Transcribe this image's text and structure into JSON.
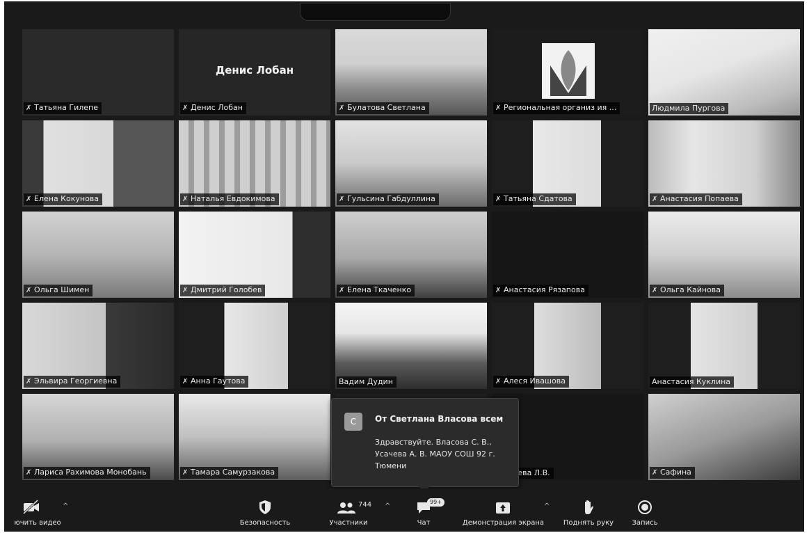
{
  "participants": [
    {
      "name": "Татьяна Гилепе",
      "display": "",
      "muted": true
    },
    {
      "name": "Денис Лобан",
      "display": "Денис Лобан",
      "muted": true
    },
    {
      "name": "Булатова Светлана",
      "display": "",
      "muted": true
    },
    {
      "name": "Региональная организ ия ...",
      "display": "",
      "muted": true
    },
    {
      "name": "Людмила Пургова",
      "display": "",
      "muted": false
    },
    {
      "name": "Елена Кокунова",
      "display": "",
      "muted": true
    },
    {
      "name": "Наталья Евдокимова",
      "display": "",
      "muted": true
    },
    {
      "name": "Гульсина Габдуллина",
      "display": "",
      "muted": true
    },
    {
      "name": "Татьяна Сдатова",
      "display": "",
      "muted": true
    },
    {
      "name": "Анастасия Попаева",
      "display": "",
      "muted": true
    },
    {
      "name": "Ольга Шимен",
      "display": "",
      "muted": true
    },
    {
      "name": "Дмитрий Голобев",
      "display": "",
      "muted": true
    },
    {
      "name": "Елена Ткаченко",
      "display": "",
      "muted": true
    },
    {
      "name": "Анастасия Рязапова",
      "display": "",
      "muted": true
    },
    {
      "name": "Ольга Кайнова",
      "display": "",
      "muted": true
    },
    {
      "name": "Эльвира Георгиевна",
      "display": "",
      "muted": true
    },
    {
      "name": "Анна Гаутова",
      "display": "",
      "muted": true
    },
    {
      "name": "Вадим Дудин",
      "display": "",
      "muted": false
    },
    {
      "name": "Алеся Ивашова",
      "display": "",
      "muted": true
    },
    {
      "name": "Анастасия Куклина",
      "display": "",
      "muted": false
    },
    {
      "name": "Лариса Рахимова Монобань",
      "display": "",
      "muted": true
    },
    {
      "name": "Тамара Самурзакова",
      "display": "",
      "muted": true
    },
    {
      "name": "",
      "display": "",
      "muted": false
    },
    {
      "name": "Шаблева Л.В.",
      "display": "",
      "muted": false
    },
    {
      "name": "Сафина",
      "display": "",
      "muted": true
    }
  ],
  "chat_popup": {
    "avatar_letter": "С",
    "sender": "От Светлана Власова всем",
    "message": "Здравствуйте. Власова С. В., Усачева А. В. МАОУ СОШ 92 г. Тюмени"
  },
  "toolbar": {
    "video_label": "ючить видео",
    "security_label": "Безопасность",
    "participants_label": "Участники",
    "participants_count": "744",
    "chat_label": "Чат",
    "chat_badge": "99+",
    "share_label": "Демонстрация экрана",
    "raise_hand_label": "Поднять руку",
    "record_label": "Запись"
  }
}
